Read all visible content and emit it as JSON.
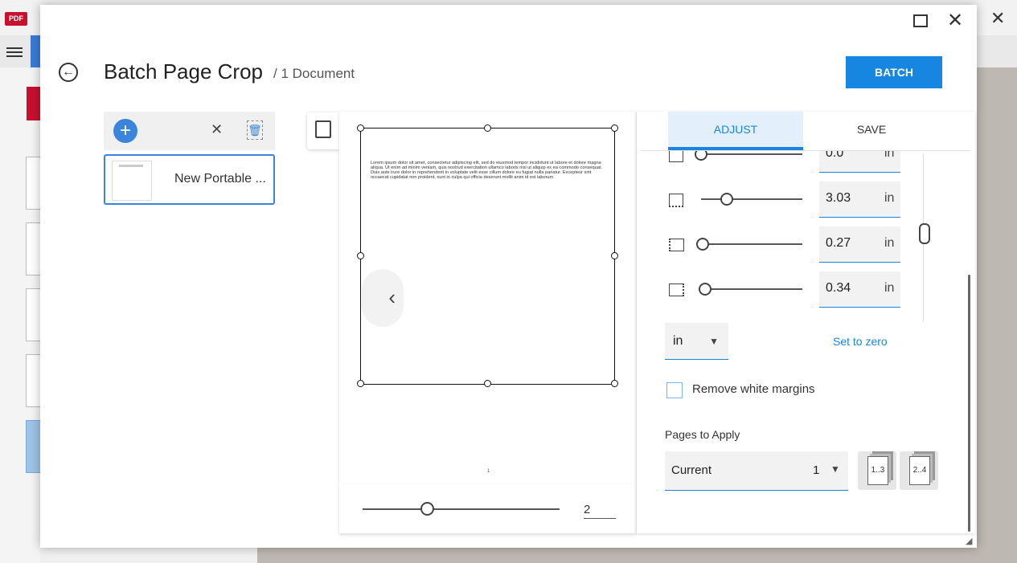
{
  "background_app": {
    "logo_text": "PDF",
    "close_glyph": "✕"
  },
  "window_controls": {
    "maximize_icon": "maximize-icon",
    "close_glyph": "✕"
  },
  "header": {
    "back_glyph": "←",
    "title": "Batch Page Crop",
    "subtitle": "/ 1 Document",
    "batch_label": "BATCH"
  },
  "file_list": {
    "add_glyph": "+",
    "clear_glyph": "✕",
    "items": [
      {
        "name": "New Portable ..."
      }
    ]
  },
  "preview": {
    "page_text": "Lorem ipsum dolor sit amet, consectetur adipiscing elit, sed do eiusmod tempor incididunt ut labore et dolore magna aliqua. Ut enim ad minim veniam, quis nostrud exercitation ullamco laboris nisi ut aliquip ex ea commodo consequat. Duis aute irure dolor in reprehenderit in voluptate velit esse cillum dolore eu fugiat nulla pariatur. Excepteur sint occaecat cupidatat non proident, sunt in culpa qui officia deserunt mollit anim id est laborum.",
    "page_number": "1",
    "prev_glyph": "‹",
    "next_glyph": "›",
    "zoom_value": "2"
  },
  "panel": {
    "tabs": [
      {
        "label": "ADJUST",
        "active": true
      },
      {
        "label": "SAVE",
        "active": false
      }
    ],
    "margins": [
      {
        "name": "top",
        "value": "0.0",
        "unit": "in",
        "slider_fraction": 0.0
      },
      {
        "name": "bottom",
        "value": "3.03",
        "unit": "in",
        "slider_fraction": 0.27
      },
      {
        "name": "left",
        "value": "0.27",
        "unit": "in",
        "slider_fraction": 0.02
      },
      {
        "name": "right",
        "value": "0.34",
        "unit": "in",
        "slider_fraction": 0.04
      }
    ],
    "unit_selected": "in",
    "set_zero_label": "Set to zero",
    "remove_margins_label": "Remove white margins",
    "remove_margins_checked": false,
    "pages_label": "Pages to Apply",
    "pages_option": "Current",
    "pages_number": "1",
    "odd_pages_label": "1..3",
    "even_pages_label": "2..4"
  },
  "colors": {
    "accent": "#1786e0",
    "brand_red": "#c8102e"
  }
}
